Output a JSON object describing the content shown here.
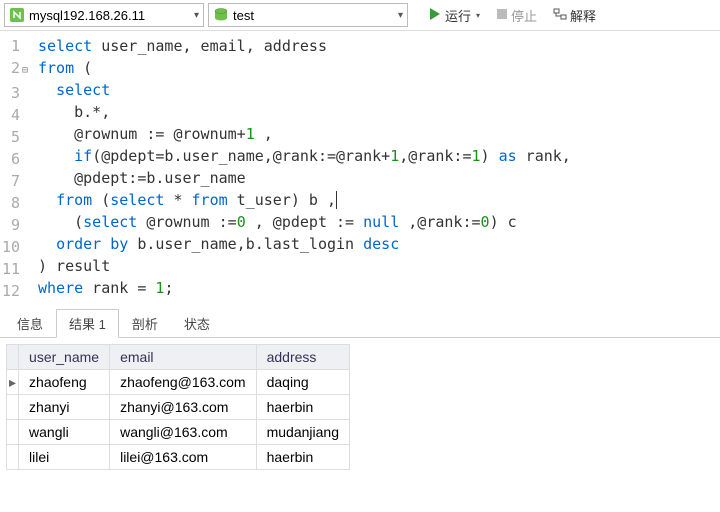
{
  "toolbar": {
    "connection": "mysql192.168.26.11",
    "database": "test",
    "run_label": "运行",
    "stop_label": "停止",
    "explain_label": "解释"
  },
  "editor": {
    "lines": [
      {
        "n": "1",
        "fold": "",
        "tokens": [
          {
            "t": "select",
            "c": "kw"
          },
          {
            "t": " user_name, email, address",
            "c": ""
          }
        ]
      },
      {
        "n": "2",
        "fold": "⊟",
        "tokens": [
          {
            "t": "from",
            "c": "kw"
          },
          {
            "t": " (",
            "c": ""
          }
        ]
      },
      {
        "n": "3",
        "fold": "",
        "tokens": [
          {
            "t": "  ",
            "c": ""
          },
          {
            "t": "select",
            "c": "kw"
          }
        ]
      },
      {
        "n": "4",
        "fold": "",
        "tokens": [
          {
            "t": "    b.*,",
            "c": ""
          }
        ]
      },
      {
        "n": "5",
        "fold": "",
        "tokens": [
          {
            "t": "    @rownum := @rownum+",
            "c": ""
          },
          {
            "t": "1",
            "c": "num"
          },
          {
            "t": " ,",
            "c": ""
          }
        ]
      },
      {
        "n": "6",
        "fold": "",
        "tokens": [
          {
            "t": "    ",
            "c": ""
          },
          {
            "t": "if",
            "c": "kw"
          },
          {
            "t": "(@pdept=b.user_name,@rank:=@rank+",
            "c": ""
          },
          {
            "t": "1",
            "c": "num"
          },
          {
            "t": ",@rank:=",
            "c": ""
          },
          {
            "t": "1",
            "c": "num"
          },
          {
            "t": ") ",
            "c": ""
          },
          {
            "t": "as",
            "c": "kw"
          },
          {
            "t": " rank,",
            "c": ""
          }
        ]
      },
      {
        "n": "7",
        "fold": "",
        "tokens": [
          {
            "t": "    @pdept:=b.user_name",
            "c": ""
          }
        ]
      },
      {
        "n": "8",
        "fold": "",
        "tokens": [
          {
            "t": "  ",
            "c": ""
          },
          {
            "t": "from",
            "c": "kw"
          },
          {
            "t": " (",
            "c": ""
          },
          {
            "t": "select",
            "c": "kw"
          },
          {
            "t": " * ",
            "c": ""
          },
          {
            "t": "from",
            "c": "kw"
          },
          {
            "t": " t_user) b ,",
            "c": ""
          },
          {
            "t": "",
            "c": "cursor"
          }
        ]
      },
      {
        "n": "9",
        "fold": "",
        "tokens": [
          {
            "t": "    (",
            "c": ""
          },
          {
            "t": "select",
            "c": "kw"
          },
          {
            "t": " @rownum :=",
            "c": ""
          },
          {
            "t": "0",
            "c": "num"
          },
          {
            "t": " , @pdept := ",
            "c": ""
          },
          {
            "t": "null",
            "c": "kw"
          },
          {
            "t": " ,@rank:=",
            "c": ""
          },
          {
            "t": "0",
            "c": "num"
          },
          {
            "t": ") c",
            "c": ""
          }
        ]
      },
      {
        "n": "10",
        "fold": "",
        "tokens": [
          {
            "t": "  ",
            "c": ""
          },
          {
            "t": "order by",
            "c": "kw"
          },
          {
            "t": " b.user_name,b.last_login ",
            "c": ""
          },
          {
            "t": "desc",
            "c": "kw"
          }
        ]
      },
      {
        "n": "11",
        "fold": "",
        "tokens": [
          {
            "t": ") result",
            "c": ""
          }
        ]
      },
      {
        "n": "12",
        "fold": "",
        "tokens": [
          {
            "t": "where",
            "c": "kw"
          },
          {
            "t": " rank = ",
            "c": ""
          },
          {
            "t": "1",
            "c": "num"
          },
          {
            "t": ";",
            "c": ""
          }
        ]
      }
    ]
  },
  "tabs": [
    {
      "label": "信息",
      "active": false
    },
    {
      "label": "结果 1",
      "active": true
    },
    {
      "label": "剖析",
      "active": false
    },
    {
      "label": "状态",
      "active": false
    }
  ],
  "results": {
    "columns": [
      "user_name",
      "email",
      "address"
    ],
    "rows": [
      {
        "ptr": "▸",
        "cells": [
          "zhaofeng",
          "zhaofeng@163.com",
          "daqing"
        ]
      },
      {
        "ptr": "",
        "cells": [
          "zhanyi",
          "zhanyi@163.com",
          "haerbin"
        ]
      },
      {
        "ptr": "",
        "cells": [
          "wangli",
          "wangli@163.com",
          "mudanjiang"
        ]
      },
      {
        "ptr": "",
        "cells": [
          "lilei",
          "lilei@163.com",
          "haerbin"
        ]
      }
    ]
  }
}
